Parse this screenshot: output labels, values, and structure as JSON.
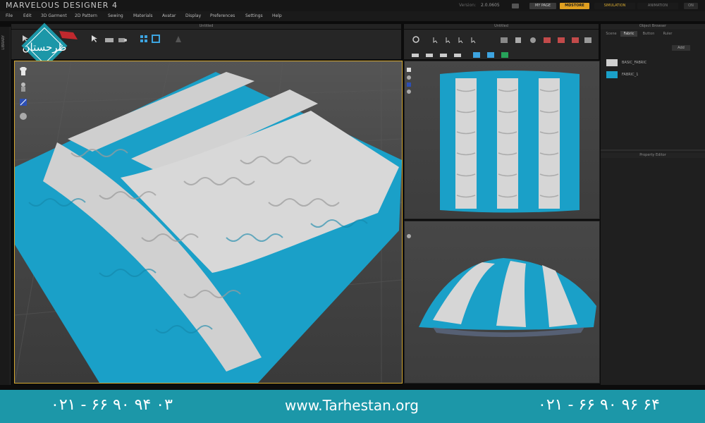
{
  "app": {
    "title": "MARVELOUS DESIGNER 4",
    "version_label": "Version:",
    "version": "2.0.0605"
  },
  "modes": {
    "simulation": "SIMULATION",
    "animation": "ANIMATION",
    "my_page": "MY PAGE",
    "mdstore": "MDSTORE",
    "on": "ON"
  },
  "menu": [
    "File",
    "Edit",
    "3D Garment",
    "2D Pattern",
    "Sewing",
    "Materials",
    "Avatar",
    "Display",
    "Preferences",
    "Settings",
    "Help"
  ],
  "panels": {
    "main": "Untitled",
    "right": "Untitled",
    "library": "LIBRARY"
  },
  "object_browser": {
    "title": "Object Browser",
    "tabs": [
      "Scene",
      "Fabric",
      "Button",
      "Ruler"
    ],
    "add_label": "Add",
    "items": [
      {
        "name": "BASIC_FABRIC",
        "color": "#cfcfcf"
      },
      {
        "name": "FABRIC_1",
        "color": "#1aa0c8"
      }
    ]
  },
  "property_editor": {
    "title": "Property Editor"
  },
  "footer": {
    "phone_left": "۰۲۱ - ۶۶ ۹۰ ۹۴ ۰۳",
    "website": "www.Tarhestan.org",
    "phone_right": "۰۲۱ - ۶۶ ۹۰ ۹۶ ۶۴"
  },
  "logo_text": "طرحستان",
  "colors": {
    "accent": "#d4a730",
    "fabric_blue": "#1aa0c8",
    "fabric_white": "#d6d6d6",
    "footer": "#1c97a8"
  }
}
